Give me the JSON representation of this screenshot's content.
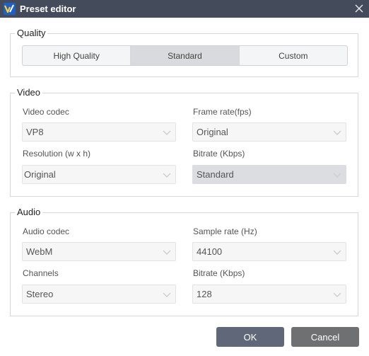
{
  "window": {
    "title": "Preset editor",
    "close_icon": "close-icon",
    "app_icon": "app-logo-icon"
  },
  "quality": {
    "legend": "Quality",
    "options": [
      "High Quality",
      "Standard",
      "Custom"
    ],
    "selected": "Standard"
  },
  "video": {
    "legend": "Video",
    "codec": {
      "label": "Video codec",
      "value": "VP8"
    },
    "frame_rate": {
      "label": "Frame rate(fps)",
      "value": "Original"
    },
    "resolution": {
      "label": "Resolution (w x h)",
      "value": "Original"
    },
    "bitrate": {
      "label": "Bitrate (Kbps)",
      "value": "Standard"
    }
  },
  "audio": {
    "legend": "Audio",
    "codec": {
      "label": "Audio codec",
      "value": "WebM"
    },
    "sample_rate": {
      "label": "Sample rate (Hz)",
      "value": "44100"
    },
    "channels": {
      "label": "Channels",
      "value": "Stereo"
    },
    "bitrate": {
      "label": "Bitrate (Kbps)",
      "value": "128"
    }
  },
  "buttons": {
    "ok": "OK",
    "cancel": "Cancel"
  },
  "colors": {
    "titlebar": "#444c5c",
    "ok_button": "#5f6779",
    "cancel_button": "#6f7072",
    "selected_segment": "#d8dadd"
  }
}
